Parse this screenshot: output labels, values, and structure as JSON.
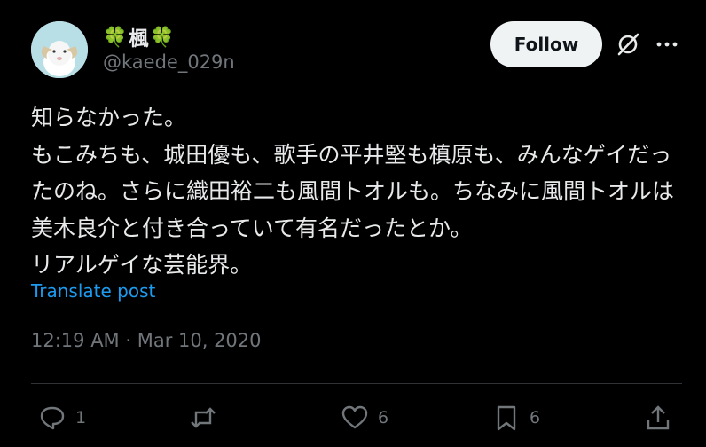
{
  "author": {
    "display_name_left_emoji": "🍀",
    "display_name": "楓",
    "display_name_right_emoji": "🍀",
    "handle": "@kaede_029n"
  },
  "header": {
    "follow_label": "Follow",
    "icons": [
      "grok-icon",
      "more-icon"
    ]
  },
  "post": {
    "text": "知らなかった。\nもこみちも、城田優も、歌手の平井堅も槙原も、みんなゲイだったのね。さらに織田裕二も風間トオルも。ちなみに風間トオルは美木良介と付き合っていて有名だったとか。\nリアルゲイな芸能界。",
    "translate_label": "Translate post",
    "timestamp": "12:19 AM · Mar 10, 2020"
  },
  "actions": {
    "reply_count": "1",
    "retweet_count": "",
    "like_count": "6",
    "bookmark_count": "6"
  },
  "colors": {
    "background": "#000000",
    "text": "#e7e9ea",
    "secondary": "#71767b",
    "link": "#1d9bf0",
    "follow_bg": "#eff3f4"
  }
}
